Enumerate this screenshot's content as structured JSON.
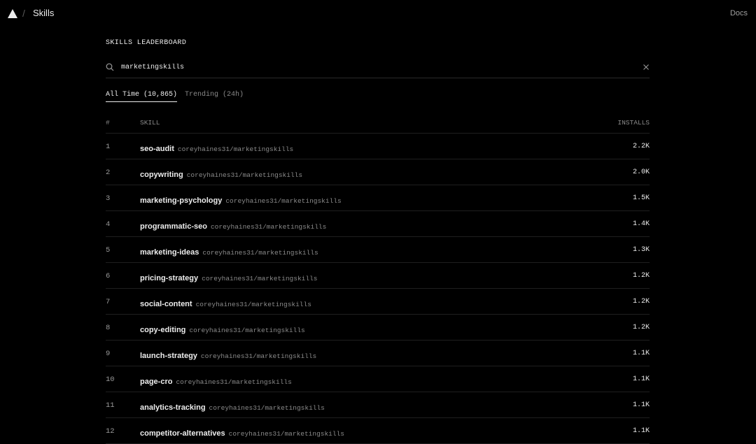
{
  "header": {
    "separator": "/",
    "title": "Skills",
    "docs_label": "Docs"
  },
  "leaderboard": {
    "heading": "SKILLS LEADERBOARD",
    "search": {
      "value": "marketingskills",
      "icon": "search-icon"
    },
    "tabs": [
      {
        "label": "All Time (10,865)",
        "active": true
      },
      {
        "label": "Trending (24h)",
        "active": false
      }
    ],
    "columns": {
      "rank": "#",
      "skill": "SKILL",
      "installs": "INSTALLS"
    },
    "rows": [
      {
        "rank": "1",
        "name": "seo-audit",
        "source": "coreyhaines31/marketingskills",
        "installs": "2.2K"
      },
      {
        "rank": "2",
        "name": "copywriting",
        "source": "coreyhaines31/marketingskills",
        "installs": "2.0K"
      },
      {
        "rank": "3",
        "name": "marketing-psychology",
        "source": "coreyhaines31/marketingskills",
        "installs": "1.5K"
      },
      {
        "rank": "4",
        "name": "programmatic-seo",
        "source": "coreyhaines31/marketingskills",
        "installs": "1.4K"
      },
      {
        "rank": "5",
        "name": "marketing-ideas",
        "source": "coreyhaines31/marketingskills",
        "installs": "1.3K"
      },
      {
        "rank": "6",
        "name": "pricing-strategy",
        "source": "coreyhaines31/marketingskills",
        "installs": "1.2K"
      },
      {
        "rank": "7",
        "name": "social-content",
        "source": "coreyhaines31/marketingskills",
        "installs": "1.2K"
      },
      {
        "rank": "8",
        "name": "copy-editing",
        "source": "coreyhaines31/marketingskills",
        "installs": "1.2K"
      },
      {
        "rank": "9",
        "name": "launch-strategy",
        "source": "coreyhaines31/marketingskills",
        "installs": "1.1K"
      },
      {
        "rank": "10",
        "name": "page-cro",
        "source": "coreyhaines31/marketingskills",
        "installs": "1.1K"
      },
      {
        "rank": "11",
        "name": "analytics-tracking",
        "source": "coreyhaines31/marketingskills",
        "installs": "1.1K"
      },
      {
        "rank": "12",
        "name": "competitor-alternatives",
        "source": "coreyhaines31/marketingskills",
        "installs": "1.1K"
      }
    ]
  },
  "colors": {
    "background": "#000000",
    "text": "#ededed",
    "muted": "#8a8a8a",
    "divider": "#1f1f1f"
  }
}
